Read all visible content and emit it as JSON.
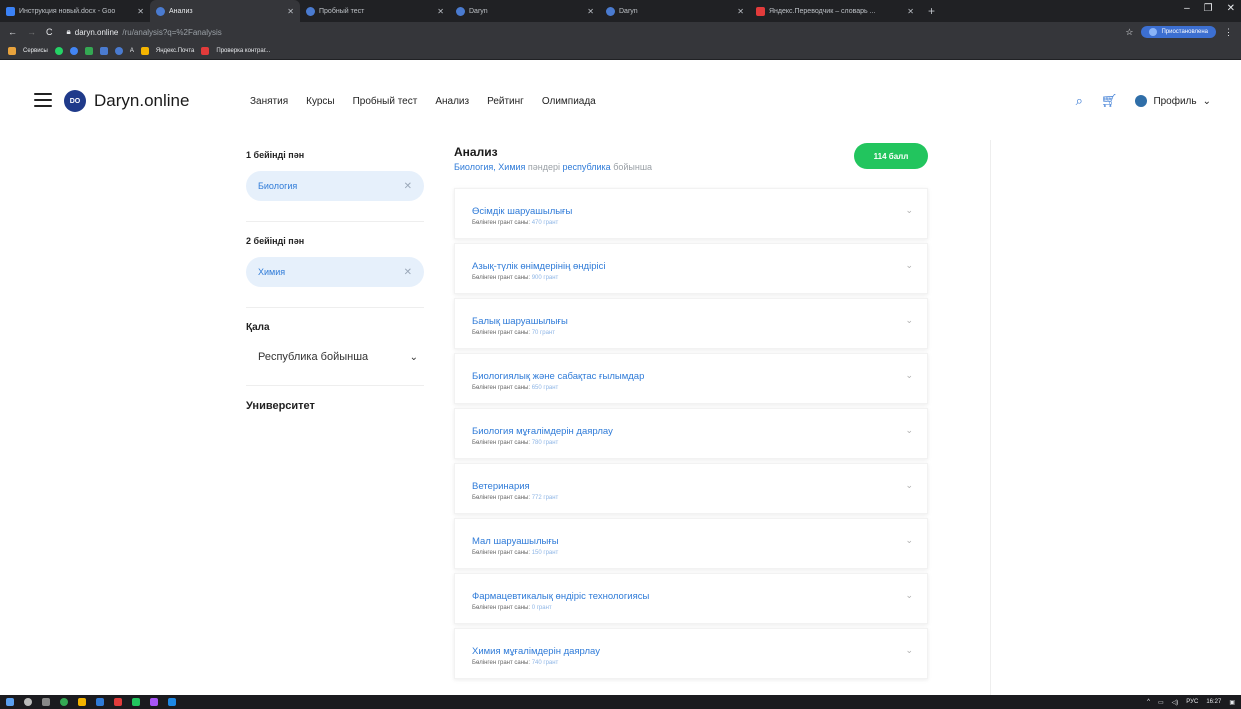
{
  "browser": {
    "tabs": [
      {
        "label": "Инструкция новый.docx - Goo",
        "icon": "docs-icon",
        "active": false
      },
      {
        "label": "Анализ",
        "icon": "daryn-icon",
        "active": true
      },
      {
        "label": "Пробный тест",
        "icon": "daryn-icon",
        "active": false
      },
      {
        "label": "Daryn",
        "icon": "daryn-icon",
        "active": false
      },
      {
        "label": "Daryn",
        "icon": "daryn-icon",
        "active": false
      },
      {
        "label": "Яндекс.Переводчик – словарь ...",
        "icon": "yandex-translate-icon",
        "active": false
      }
    ],
    "new_tab": "+",
    "url_host": "daryn.online",
    "url_path": "/ru/analysis?q=%2Fanalysis",
    "profile_button": "Приостановлена",
    "bookmarks": [
      "Сервисы",
      "A",
      "Яндекс.Почта",
      "Проверка контраг..."
    ]
  },
  "header": {
    "logo_mark": "DO",
    "logo_text": "Daryn.online",
    "nav": [
      "Занятия",
      "Курсы",
      "Пробный тест",
      "Анализ",
      "Рейтинг",
      "Олимпиада"
    ],
    "profile_label": "Профиль"
  },
  "filters": {
    "subject1_label": "1 бейінді пән",
    "subject1_value": "Биология",
    "subject2_label": "2 бейінді пән",
    "subject2_value": "Химия",
    "city_label": "Қала",
    "city_value": "Республика бойынша",
    "university_label": "Университет"
  },
  "analysis": {
    "title": "Анализ",
    "sub_subjects": "Биология, Химия",
    "sub_mid": " пәндері ",
    "sub_region": "республика",
    "sub_end": " бойынша",
    "score": "114 балл",
    "grant_prefix": "Бөлінген грант саны:",
    "items": [
      {
        "title": "Өсімдік шаруашылығы",
        "grants": "470 грант"
      },
      {
        "title": "Азық-түлік өнімдерінің өндірісі",
        "grants": "900 грант"
      },
      {
        "title": "Балық шаруашылығы",
        "grants": "70 грант"
      },
      {
        "title": "Биологиялық және сабақтас ғылымдар",
        "grants": "650 грант"
      },
      {
        "title": "Биология мұғалімдерін даярлау",
        "grants": "780 грант"
      },
      {
        "title": "Ветеринария",
        "grants": "772 грант"
      },
      {
        "title": "Мал шаруашылығы",
        "grants": "150 грант"
      },
      {
        "title": "Фармацевтикалық өндіріс технологиясы",
        "grants": "0 грант"
      },
      {
        "title": "Химия мұғалімдерін даярлау",
        "grants": "740 грант"
      }
    ]
  },
  "taskbar": {
    "lang": "РУС",
    "time": "16:27"
  },
  "colors": {
    "accent_blue": "#2f7bd8",
    "score_green": "#22c55e",
    "chip_bg": "#e6f0fb"
  }
}
